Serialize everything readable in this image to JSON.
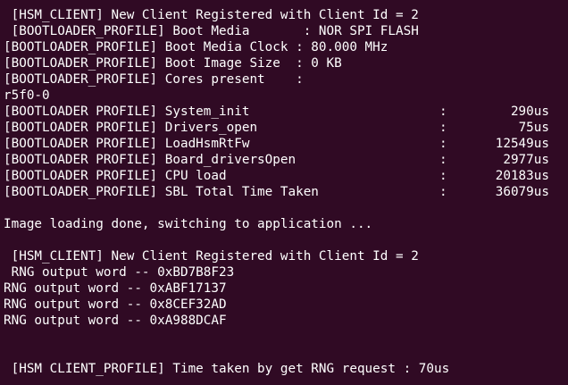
{
  "terminal": {
    "background": "#300a24",
    "foreground": "#ffffff",
    "lines_top": [
      " [HSM_CLIENT] New Client Registered with Client Id = 2",
      " [BOOTLOADER_PROFILE] Boot Media       : NOR SPI FLASH",
      "[BOOTLOADER_PROFILE] Boot Media Clock : 80.000 MHz",
      "[BOOTLOADER_PROFILE] Boot Image Size  : 0 KB",
      "[BOOTLOADER_PROFILE] Cores present    :",
      "r5f0-0"
    ],
    "profile_rows": [
      {
        "label": "[BOOTLOADER PROFILE] System_init",
        "colon": ":",
        "value": "290us"
      },
      {
        "label": "[BOOTLOADER PROFILE] Drivers_open",
        "colon": ":",
        "value": "75us"
      },
      {
        "label": "[BOOTLOADER PROFILE] LoadHsmRtFw",
        "colon": ":",
        "value": "12549us"
      },
      {
        "label": "[BOOTLOADER PROFILE] Board_driversOpen",
        "colon": ":",
        "value": "2977us"
      },
      {
        "label": "[BOOTLOADER PROFILE] CPU load",
        "colon": ":",
        "value": "20183us"
      },
      {
        "label": "[BOOTLOADER_PROFILE] SBL Total Time Taken",
        "colon": ":",
        "value": "36079us"
      }
    ],
    "image_loading": "Image loading done, switching to application ...",
    "lines_rng": [
      " [HSM_CLIENT] New Client Registered with Client Id = 2",
      " RNG output word -- 0xBD7B8F23",
      "RNG output word -- 0xABF17137",
      "RNG output word -- 0x8CEF32AD",
      "RNG output word -- 0xA988DCAF"
    ],
    "final_line": " [HSM CLIENT_PROFILE] Time taken by get RNG request : 70us"
  }
}
